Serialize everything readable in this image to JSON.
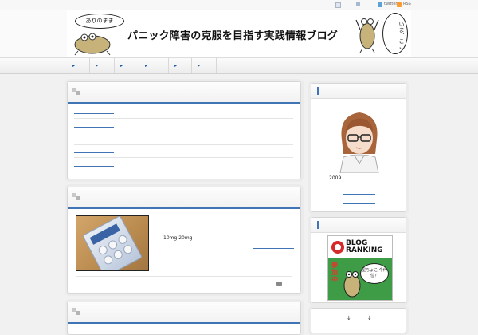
{
  "topbar": {
    "twitter_label": "twitter",
    "rss_label": "RSS"
  },
  "header": {
    "bubble_left": "ありのまま",
    "site_title": "パニック障害の克服を目指す実践情報ブログ",
    "bubble_right": "いま、ここ"
  },
  "nav": {
    "items": [
      {
        "arrow": "▸"
      },
      {
        "arrow": "▸"
      },
      {
        "arrow": "▸"
      },
      {
        "arrow": "▸"
      },
      {
        "arrow": "▸"
      },
      {
        "arrow": "▸"
      }
    ]
  },
  "post2": {
    "dose_text": "10mg  20mg"
  },
  "sidebar": {
    "profile_year": "2009",
    "ranking": {
      "blog": "BLOG",
      "ranking": "RANKING",
      "joining": "参加中",
      "bubble": "星ちょこ 今何位？"
    },
    "bottom_arrows": [
      "↓",
      "↓"
    ]
  },
  "colors": {
    "accent": "#3f74b5",
    "background": "#f1f1f1",
    "panel": "#ffffff"
  }
}
